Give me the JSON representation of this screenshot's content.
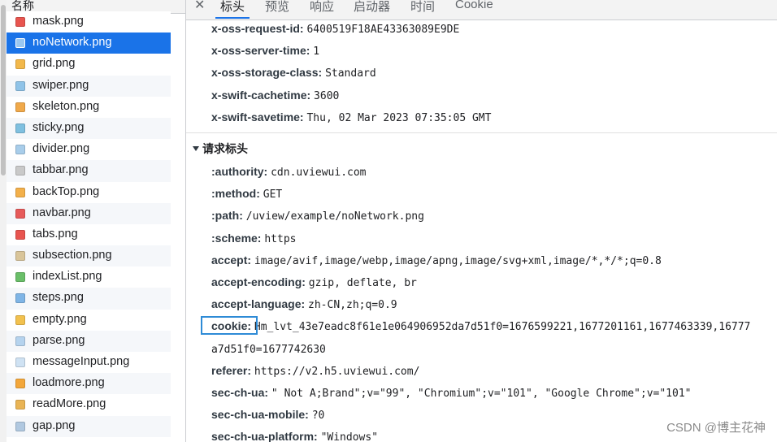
{
  "file_list": {
    "column_header": "名称",
    "selected_index": 1,
    "items": [
      {
        "name": "mask.png",
        "icon": "image-file-icon",
        "color": "#e8554f"
      },
      {
        "name": "noNetwork.png",
        "icon": "image-file-icon",
        "color": "#9ac7f0"
      },
      {
        "name": "grid.png",
        "icon": "image-file-icon",
        "color": "#f2b84b"
      },
      {
        "name": "swiper.png",
        "icon": "image-file-icon",
        "color": "#8fc3e8"
      },
      {
        "name": "skeleton.png",
        "icon": "image-file-icon",
        "color": "#f0a94a"
      },
      {
        "name": "sticky.png",
        "icon": "image-file-icon",
        "color": "#7fc0e0"
      },
      {
        "name": "divider.png",
        "icon": "image-file-icon",
        "color": "#a8cdea"
      },
      {
        "name": "tabbar.png",
        "icon": "image-file-icon",
        "color": "#c9c9c9"
      },
      {
        "name": "backTop.png",
        "icon": "image-file-icon",
        "color": "#f3b04a"
      },
      {
        "name": "navbar.png",
        "icon": "image-file-icon",
        "color": "#e65a5a"
      },
      {
        "name": "tabs.png",
        "icon": "image-file-icon",
        "color": "#e8554f"
      },
      {
        "name": "subsection.png",
        "icon": "image-file-icon",
        "color": "#d9c59a"
      },
      {
        "name": "indexList.png",
        "icon": "image-file-icon",
        "color": "#6abf69"
      },
      {
        "name": "steps.png",
        "icon": "image-file-icon",
        "color": "#7fb5e6"
      },
      {
        "name": "empty.png",
        "icon": "image-file-icon",
        "color": "#f2c14e"
      },
      {
        "name": "parse.png",
        "icon": "image-file-icon",
        "color": "#b5d3ee"
      },
      {
        "name": "messageInput.png",
        "icon": "image-file-icon",
        "color": "#cfe2f3"
      },
      {
        "name": "loadmore.png",
        "icon": "image-file-icon",
        "color": "#f3a73b"
      },
      {
        "name": "readMore.png",
        "icon": "image-file-icon",
        "color": "#e9b455"
      },
      {
        "name": "gap.png",
        "icon": "image-file-icon",
        "color": "#b0c8e0"
      }
    ]
  },
  "tabs": {
    "close_icon": "close-icon",
    "items": [
      {
        "label": "标头",
        "active": true
      },
      {
        "label": "预览",
        "active": false
      },
      {
        "label": "响应",
        "active": false
      },
      {
        "label": "启动器",
        "active": false
      },
      {
        "label": "时间",
        "active": false
      },
      {
        "label": "Cookie",
        "active": false
      }
    ]
  },
  "response_headers_tail": [
    {
      "key": "x-oss-request-id:",
      "value": "6400519F18AE43363089E9DE"
    },
    {
      "key": "x-oss-server-time:",
      "value": "1"
    },
    {
      "key": "x-oss-storage-class:",
      "value": "Standard"
    },
    {
      "key": "x-swift-cachetime:",
      "value": "3600"
    },
    {
      "key": "x-swift-savetime:",
      "value": "Thu, 02 Mar 2023 07:35:05 GMT"
    }
  ],
  "request_section": {
    "title": "请求标头",
    "expanded_icon": "triangle-down-icon",
    "headers": [
      {
        "key": ":authority:",
        "value": "cdn.uviewui.com"
      },
      {
        "key": ":method:",
        "value": "GET"
      },
      {
        "key": ":path:",
        "value": "/uview/example/noNetwork.png"
      },
      {
        "key": ":scheme:",
        "value": "https"
      },
      {
        "key": "accept:",
        "value": "image/avif,image/webp,image/apng,image/svg+xml,image/*,*/*;q=0.8"
      },
      {
        "key": "accept-encoding:",
        "value": "gzip, deflate, br"
      },
      {
        "key": "accept-language:",
        "value": "zh-CN,zh;q=0.9"
      },
      {
        "key": "cookie:",
        "value": "Hm_lvt_43e7eadc8f61e1e064906952da7d51f0=1676599221,1677201161,1677463339,16777"
      },
      {
        "key": "",
        "value": "a7d51f0=1677742630"
      },
      {
        "key": "referer:",
        "value": "https://v2.h5.uviewui.com/"
      },
      {
        "key": "sec-ch-ua:",
        "value": "\" Not A;Brand\";v=\"99\", \"Chromium\";v=\"101\", \"Google Chrome\";v=\"101\""
      },
      {
        "key": "sec-ch-ua-mobile:",
        "value": "?0"
      },
      {
        "key": "sec-ch-ua-platform:",
        "value": "\"Windows\""
      }
    ]
  },
  "watermark": "CSDN @博主花神"
}
